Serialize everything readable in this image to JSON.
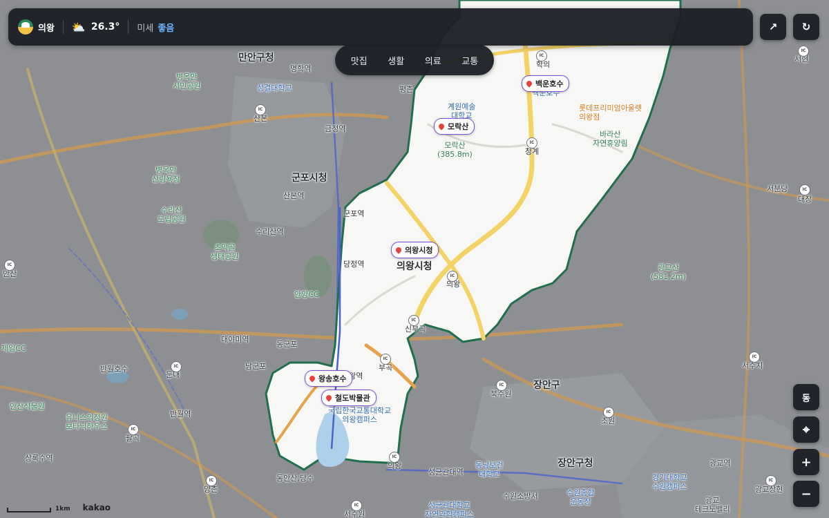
{
  "header": {
    "region": "의왕",
    "weather_icon": "cloud-sun-icon",
    "temperature": "26.3°",
    "dust_label": "미세",
    "dust_value": "좋음"
  },
  "buttons": {
    "share": "↗",
    "refresh": "↻",
    "direction": "동",
    "locate": "⌖",
    "zoom_in": "+",
    "zoom_out": "−"
  },
  "categories": [
    "맛집",
    "생활",
    "의료",
    "교통"
  ],
  "pois": {
    "baegun": "백운호수",
    "morak": "모락산",
    "cityhall": "의왕시청",
    "wangsong": "왕송호수",
    "railway": "철도박물관"
  },
  "labels": {
    "manan": "만안구청",
    "myeonghak": "명학역",
    "sungkyul": "성결대학교",
    "byeongmokan_park": "병목안\n시민공원",
    "sanbon": "산본",
    "geumjeong": "금정역",
    "gunpo_city": "군포시청",
    "byeongmokan_forest": "병목안\n산림욕장",
    "surisan": "수리산\n도립공원",
    "sanbon_stn": "산본역",
    "gunpo_stn": "군포역",
    "surisan_stn": "수리산역",
    "chomak": "초막골\n생태공원",
    "dangjeong": "당정역",
    "anyang_cc": "안양CC",
    "daeyami": "대야미역",
    "dunggongpo": "동군포",
    "namgunpo": "남군포",
    "dundae": "둔대",
    "banwol_lake": "반월호수",
    "jeil_cc": "제일CC",
    "ansan": "안산",
    "ansan_garden": "안산식물원",
    "unis": "유니스의정원\n보타닉하우스",
    "banwol_stn": "반월역",
    "palgok": "팔곡",
    "sangnoksu": "상록수역",
    "yanggam": "양촌",
    "dongan": "동안산,당수",
    "seodun": "서수원",
    "pyeongchon": "평촌",
    "gyewon": "계원예술\n대학교",
    "morak_mt": "모락산\n(385.8m)",
    "hagui": "학의",
    "baegun_sub": "백운호수",
    "lotte_outlet": "롯데프리미엄아울렛\n의왕점",
    "barasan": "바라산\n자연휴양림",
    "cheonggye": "청계",
    "uiwang_city": "의왕시청",
    "uiwang_ic": "의왕",
    "singok": "신부곡",
    "bugok": "부곡",
    "uiwang_stn": "의왕역",
    "knut": "국립한국교통대학교\n의왕캠퍼스",
    "uiwang_small": "의왕",
    "sungkyunkwan_stn": "성균관대역",
    "dongnam": "동남보건\n대학교",
    "suwon_school": "수원소방서",
    "suwon_sports": "수원종합\n운동장",
    "skku": "성균관대학교\n자연과학캠퍼스",
    "bukshuwon": "북수원",
    "jangan_gu": "장안구",
    "jangan_office": "장안구청",
    "joweon": "조원",
    "gwanggyo_mt": "광교산\n(581.2m)",
    "seobundang": "서분당",
    "daejang": "대장",
    "seohyeon": "서현",
    "seosuji": "서수지",
    "kyonggi": "경기대학교\n수원캠퍼스",
    "gwanggyo_stn": "광교역",
    "gwanggyo_up": "광교상현",
    "gwanggyo_tv": "광교\n테크노밸리"
  },
  "scale": "1km",
  "brand": "kakao",
  "colors": {
    "map_bg": "#8d8f93",
    "region_fill": "#f6f6f4",
    "boundary": "#1f6e4d",
    "road_yellow": "#f3d266",
    "road_orange": "#e8a24a",
    "pin_border": "#7a4fd6",
    "ui_dark": "#1c2026",
    "dust_good": "#6fb2ff"
  }
}
